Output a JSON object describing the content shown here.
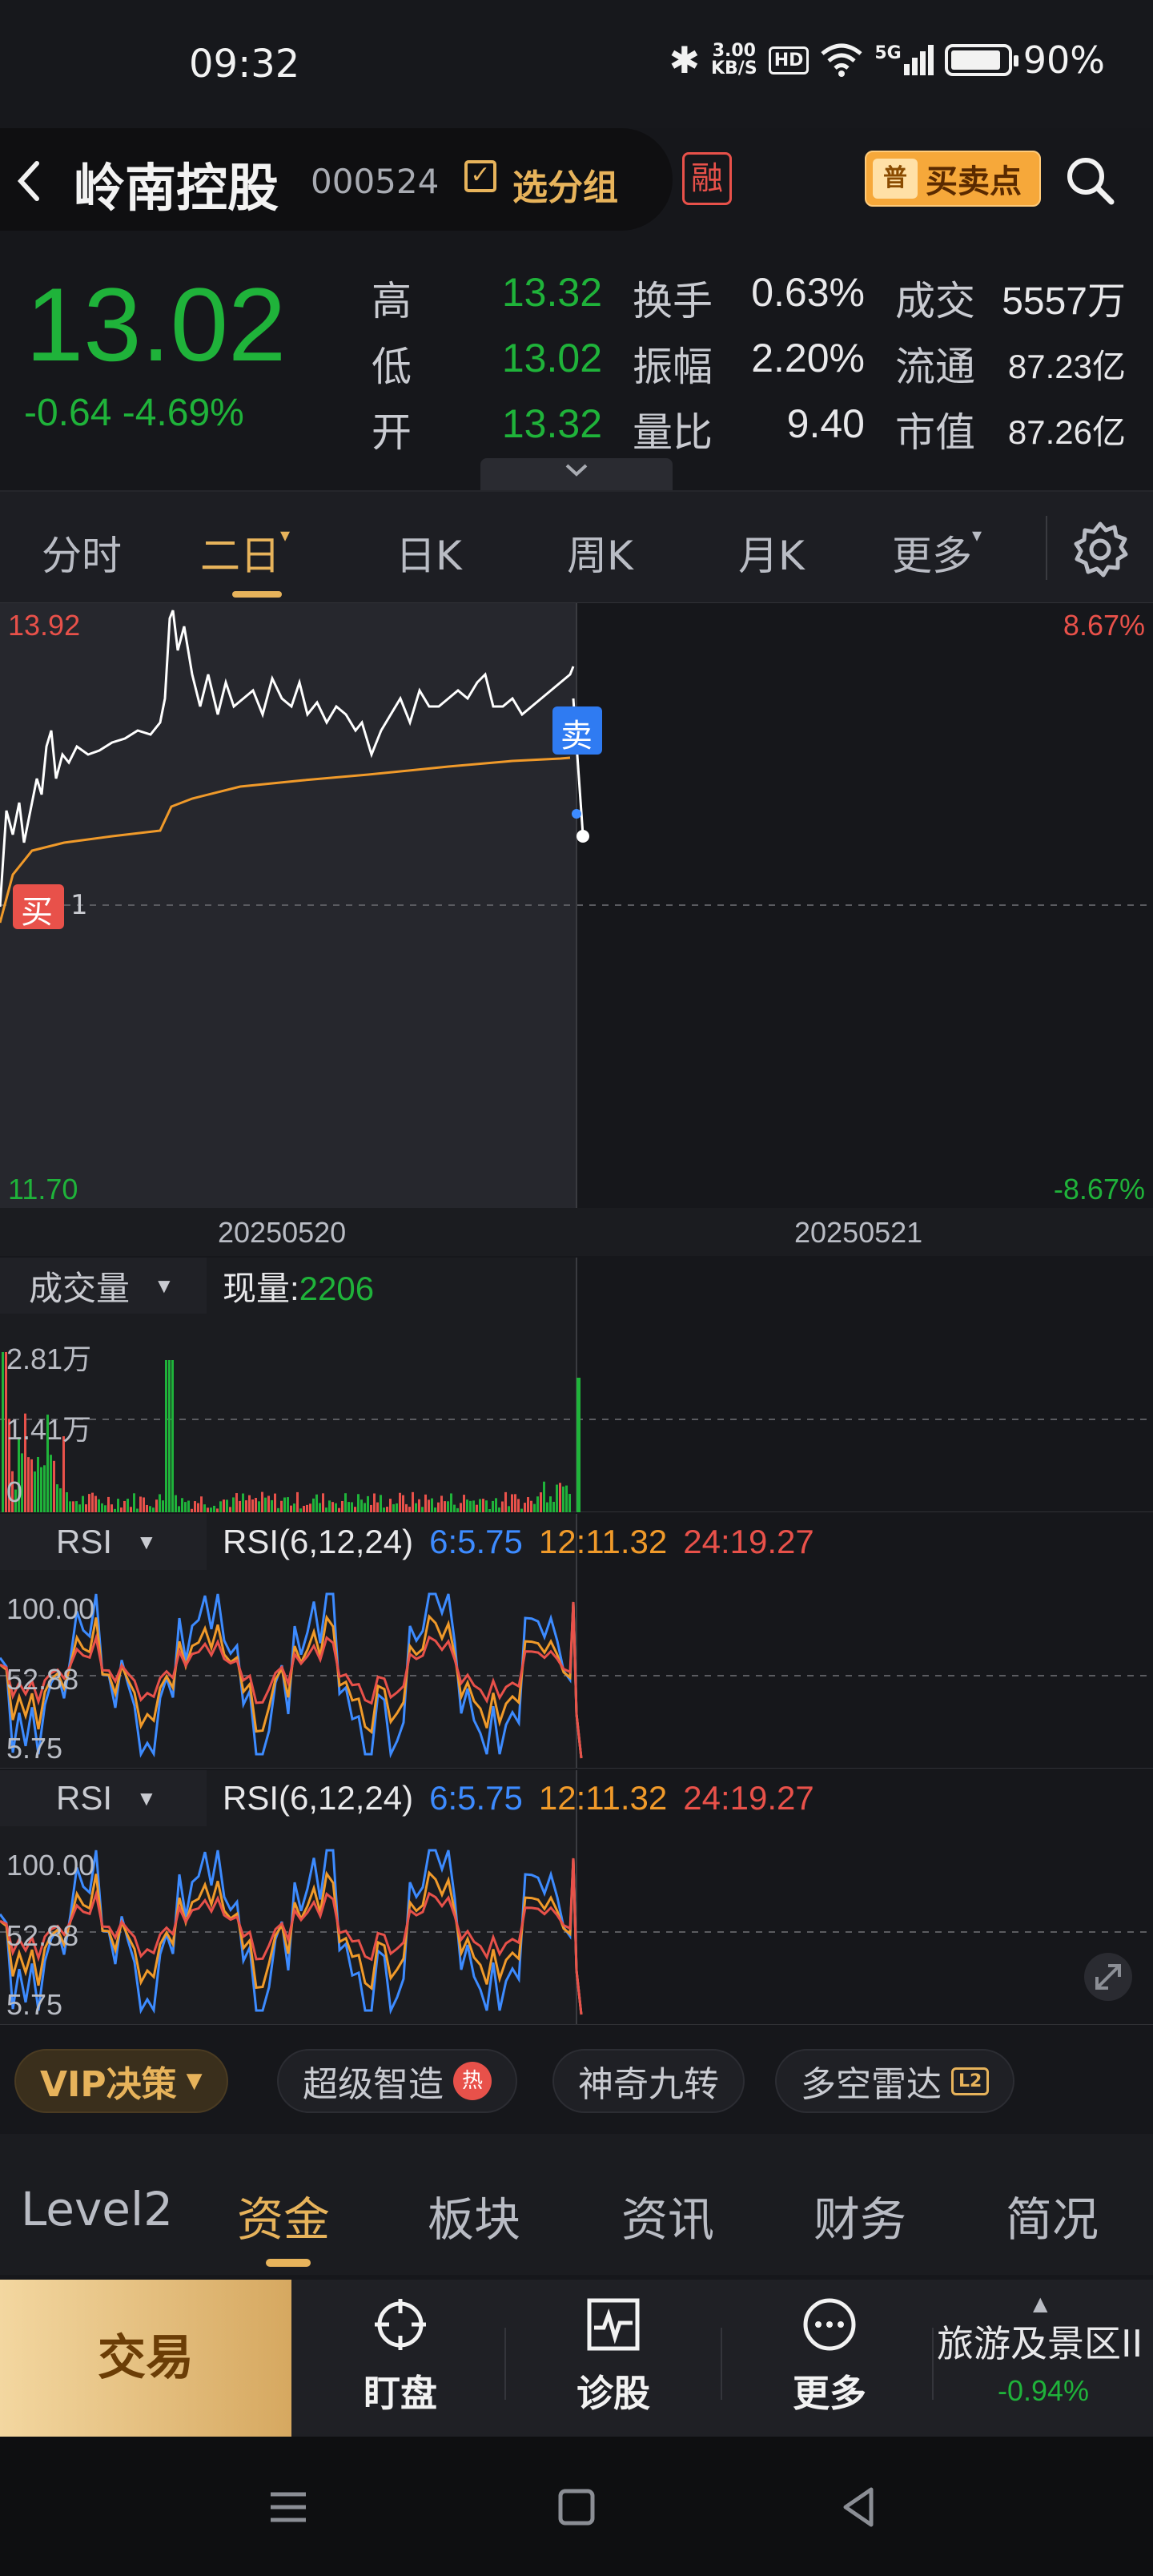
{
  "status_bar": {
    "time": "09:32",
    "net_speed_value": "3.00",
    "net_speed_unit": "KB/S",
    "hd_label": "HD",
    "signal_label": "5G",
    "battery": "90%",
    "battery_level": 0.9
  },
  "header": {
    "stock_name": "岭南控股",
    "stock_code": "000524",
    "group_label": "选分组",
    "margin_badge": "融",
    "buy_sell_icon": "普",
    "buy_sell_label": "买卖点"
  },
  "quote": {
    "price": "13.02",
    "change": "-0.64 -4.69%",
    "rows": [
      {
        "l1": "高",
        "v1": "13.32",
        "l2": "换手",
        "v2": "0.63%",
        "l3": "成交",
        "v3": "5557万"
      },
      {
        "l1": "低",
        "v1": "13.02",
        "l2": "振幅",
        "v2": "2.20%",
        "l3": "流通",
        "v3": "87.23亿"
      },
      {
        "l1": "开",
        "v1": "13.32",
        "l2": "量比",
        "v2": "9.40",
        "l3": "市值",
        "v3": "87.26亿"
      }
    ]
  },
  "tabs": {
    "items": [
      "分时",
      "二日",
      "日K",
      "周K",
      "月K",
      "更多"
    ],
    "active": "二日"
  },
  "main_chart": {
    "y_max": "13.92",
    "y_min": "11.70",
    "pct_max": "8.67%",
    "pct_min": "-8.67%",
    "buy_marker": "买",
    "buy_marker_value": "1",
    "sell_marker": "卖",
    "dates": [
      "20250520",
      "20250521"
    ]
  },
  "volume_panel": {
    "selector": "成交量",
    "current_label": "现量:",
    "current_value": "2206",
    "ticks": [
      "2.81万",
      "1.41万",
      "0"
    ]
  },
  "rsi_panels": [
    {
      "selector": "RSI",
      "title": "RSI(6,12,24)",
      "rsi6": "6:5.75",
      "rsi12": "12:11.32",
      "rsi24": "24:19.27",
      "ticks": [
        "100.00",
        "52.88",
        "5.75"
      ]
    },
    {
      "selector": "RSI",
      "title": "RSI(6,12,24)",
      "rsi6": "6:5.75",
      "rsi12": "12:11.32",
      "rsi24": "24:19.27",
      "ticks": [
        "100.00",
        "52.88",
        "5.75"
      ]
    }
  ],
  "tools": {
    "vip": "VIP决策",
    "chips": [
      "超级智造",
      "神奇九转",
      "多空雷达"
    ],
    "hot_badge": "热",
    "l2_badge": "L2"
  },
  "info_tabs": {
    "items": [
      "Level2",
      "资金",
      "板块",
      "资讯",
      "财务",
      "简况"
    ],
    "active": "资金"
  },
  "action_bar": {
    "trade": "交易",
    "watch": "盯盘",
    "diagnose": "诊股",
    "more": "更多",
    "sector_name": "旅游及景区II",
    "sector_change": "-0.94%"
  },
  "colors": {
    "up_red": "#e8514a",
    "down_green": "#1fb33a",
    "accent_gold": "#e7b35b",
    "rsi6_blue": "#3d8bff",
    "rsi12_orange": "#f09a2a",
    "rsi24_red": "#e8514a"
  }
}
